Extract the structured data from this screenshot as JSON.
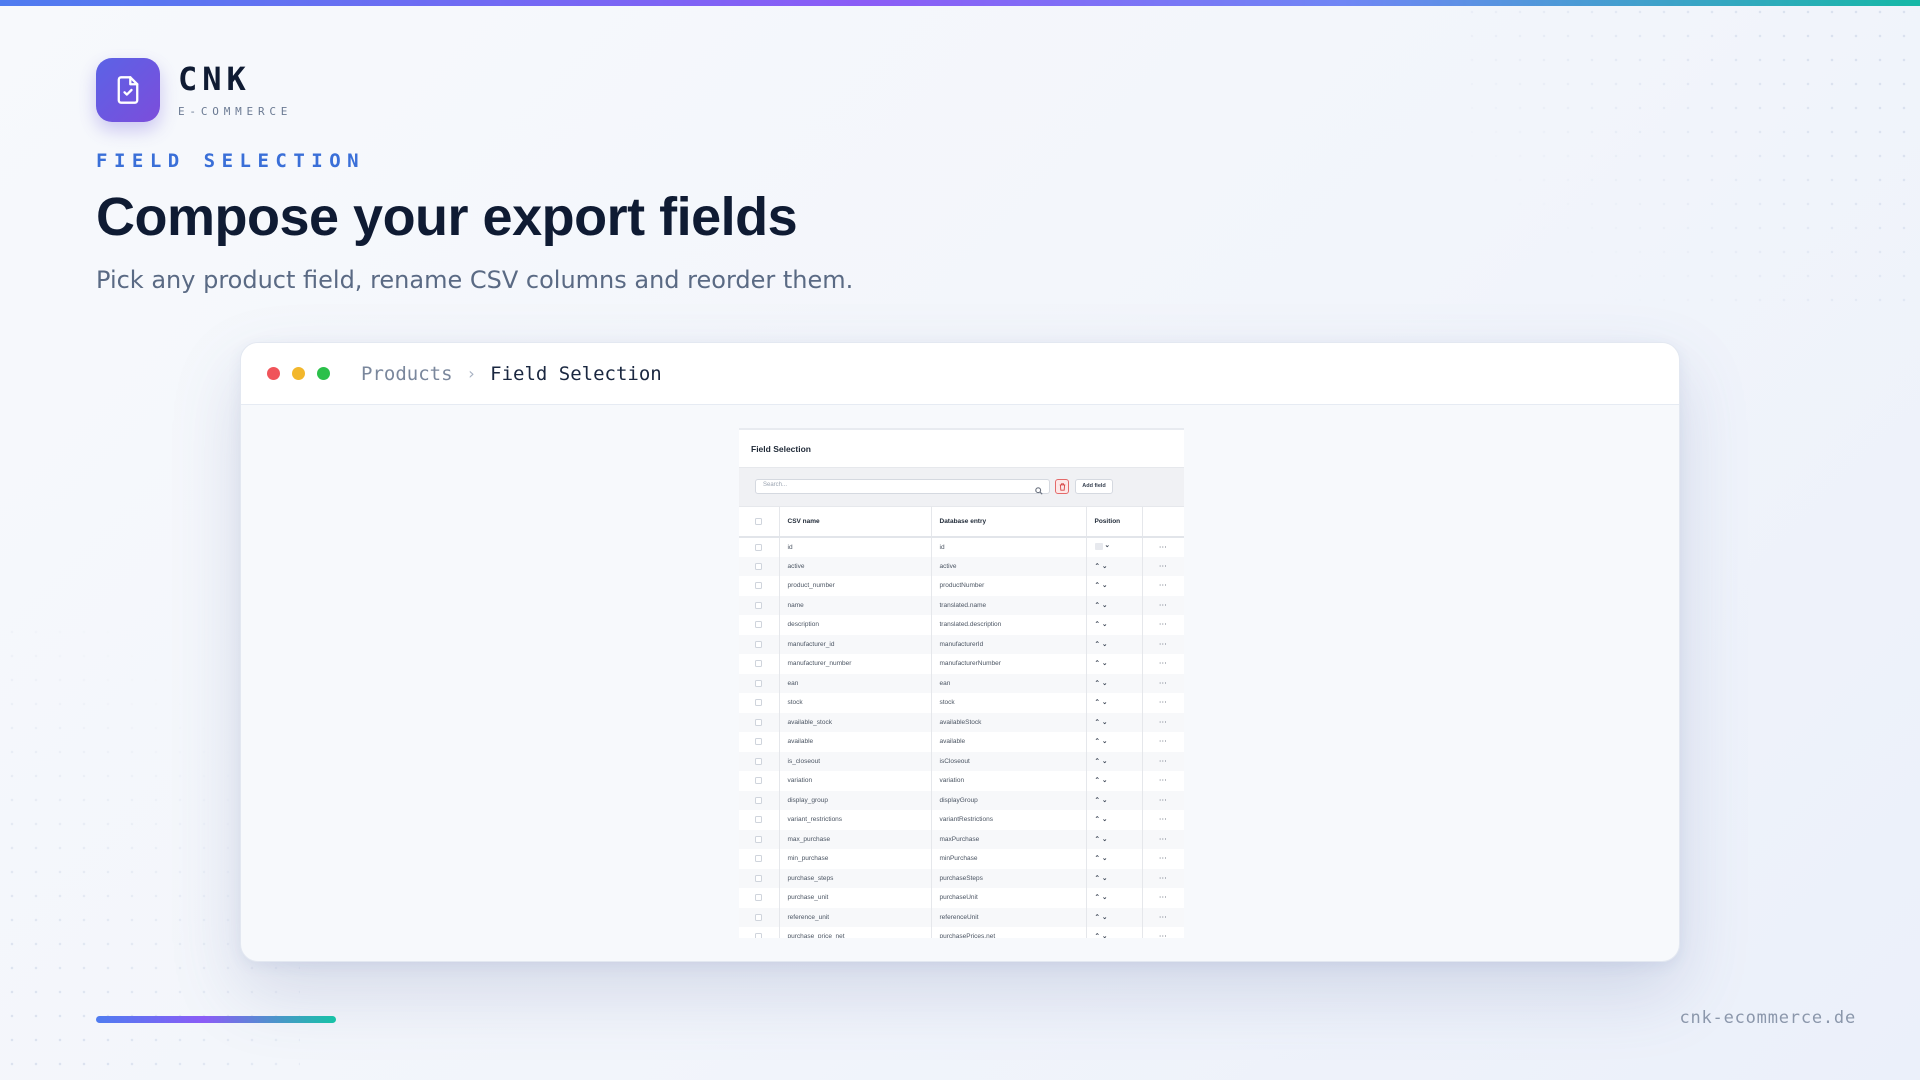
{
  "brand": {
    "name": "CNK",
    "sub": "E-COMMERCE",
    "logo_icon": "file-check-icon"
  },
  "eyebrow": "FIELD SELECTION",
  "headline": "Compose your export fields",
  "subhead": "Pick any product field, rename CSV columns and reorder them.",
  "window": {
    "breadcrumb": [
      "Products",
      "Field Selection"
    ],
    "breadcrumb_separator": "›",
    "traffic_lights": [
      "#f0545a",
      "#f2b72c",
      "#2bc04a"
    ]
  },
  "panel": {
    "title": "Field Selection",
    "search_placeholder": "Search...",
    "add_button": "Add field",
    "columns": [
      "CSV name",
      "Database entry",
      "Position"
    ],
    "rows": [
      {
        "csv": "id",
        "db": "id"
      },
      {
        "csv": "active",
        "db": "active"
      },
      {
        "csv": "product_number",
        "db": "productNumber"
      },
      {
        "csv": "name",
        "db": "translated.name"
      },
      {
        "csv": "description",
        "db": "translated.description"
      },
      {
        "csv": "manufacturer_id",
        "db": "manufacturerId"
      },
      {
        "csv": "manufacturer_number",
        "db": "manufacturerNumber"
      },
      {
        "csv": "ean",
        "db": "ean"
      },
      {
        "csv": "stock",
        "db": "stock"
      },
      {
        "csv": "available_stock",
        "db": "availableStock"
      },
      {
        "csv": "available",
        "db": "available"
      },
      {
        "csv": "is_closeout",
        "db": "isCloseout"
      },
      {
        "csv": "variation",
        "db": "variation"
      },
      {
        "csv": "display_group",
        "db": "displayGroup"
      },
      {
        "csv": "variant_restrictions",
        "db": "variantRestrictions"
      },
      {
        "csv": "max_purchase",
        "db": "maxPurchase"
      },
      {
        "csv": "min_purchase",
        "db": "minPurchase"
      },
      {
        "csv": "purchase_steps",
        "db": "purchaseSteps"
      },
      {
        "csv": "purchase_unit",
        "db": "purchaseUnit"
      },
      {
        "csv": "reference_unit",
        "db": "referenceUnit"
      },
      {
        "csv": "purchase_price_net",
        "db": "purchasePrices.net"
      }
    ]
  },
  "footer": {
    "url": "cnk-ecommerce.de"
  },
  "colors": {
    "accent": "#3a6fd8",
    "brand_gradient_start": "#5b63e6",
    "brand_gradient_end": "#7c4ddb",
    "danger": "#e46a6a"
  }
}
